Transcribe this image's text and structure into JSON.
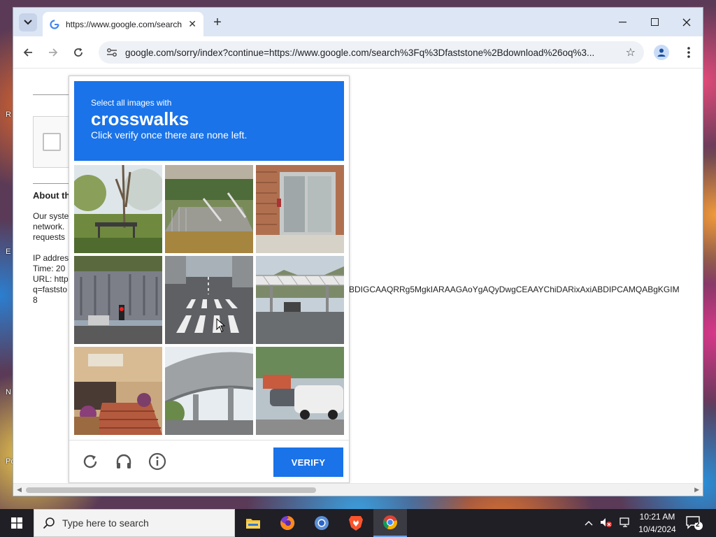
{
  "desktop": {
    "labels": [
      "R",
      "E",
      "N",
      "Po"
    ]
  },
  "browser": {
    "tab": {
      "title": "https://www.google.com/search?q=faststone",
      "favicon": "google-g-icon"
    },
    "window_controls": [
      "minimize-icon",
      "maximize-icon",
      "close-icon"
    ],
    "omnibox": {
      "url": "google.com/sorry/index?continue=https://www.google.com/search%3Fq%3Dfaststone%2Bdownload%26oq%3..."
    }
  },
  "page": {
    "about_title": "About th",
    "about_body": "Our syste\nnetwork.\nrequests\n\nIP addres\nTime: 20\nURL: http\nq=faststo\n8",
    "long_url_fragment": "BDIGCAAQRRg5MgkIARAAGAoYgAQyDwgCEAAYChiDARixAxiABDIPCAMQABgKGIM"
  },
  "captcha": {
    "header": {
      "line1": "Select all images with",
      "keyword": "crosswalks",
      "line3": "Click verify once there are none left."
    },
    "tiles": [
      "tile-trees-shelter",
      "tile-stairs-railing",
      "tile-storefront-door",
      "tile-street-traffic-light",
      "tile-crosswalk-road",
      "tile-pedestrian-bridge",
      "tile-building-steps-flowers",
      "tile-highway-overpass",
      "tile-parked-cars"
    ],
    "verify_label": "VERIFY",
    "footer_icons": [
      "reload-icon",
      "headphones-icon",
      "info-icon"
    ]
  },
  "taskbar": {
    "search_placeholder": "Type here to search",
    "time": "10:21 AM",
    "date": "10/4/2024",
    "notification_count": "2",
    "apps": [
      "file-explorer-icon",
      "firefox-icon",
      "chromium-icon",
      "brave-icon",
      "chrome-icon"
    ]
  }
}
